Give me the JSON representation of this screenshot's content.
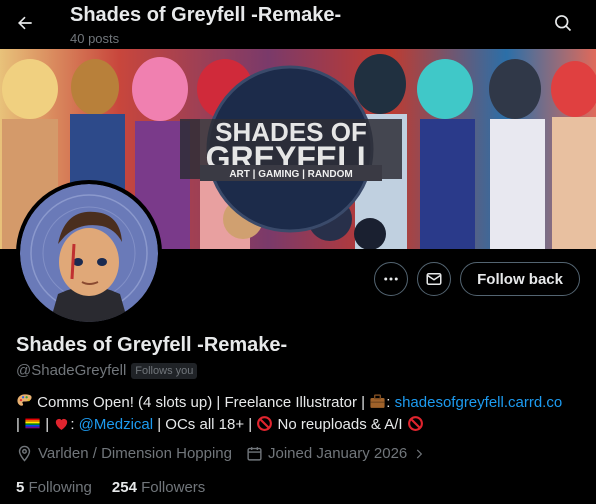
{
  "header": {
    "title": "Shades of Greyfell -Remake-",
    "post_count": "40 posts"
  },
  "banner": {
    "logo_line1": "SHADES OF",
    "logo_line2": "GREYFELL",
    "logo_tagline": "ART | GAMING | RANDOM"
  },
  "actions": {
    "follow_label": "Follow back"
  },
  "profile": {
    "display_name": "Shades of Greyfell -Remake-",
    "handle": "@ShadeGreyfell",
    "follows_you": "Follows you"
  },
  "bio": {
    "part1": " Comms Open! (4 slots up) | Freelance Illustrator | ",
    "part2": ": ",
    "link1": "shadesofgreyfell.carrd.co",
    "part3": "| ",
    "part4": " | ",
    "part5": ": ",
    "mention": "@Medzical",
    "part6": " | OCs all 18+ | ",
    "part7": " No reuploads & A/I "
  },
  "meta": {
    "location": "Varlden / Dimension Hopping",
    "joined": "Joined January 2026"
  },
  "counts": {
    "following_num": "5",
    "following_label": "Following",
    "followers_num": "254",
    "followers_label": "Followers"
  },
  "colors": {
    "accent": "#1d9bf0",
    "muted": "#71767b",
    "text": "#e7e9ea"
  }
}
